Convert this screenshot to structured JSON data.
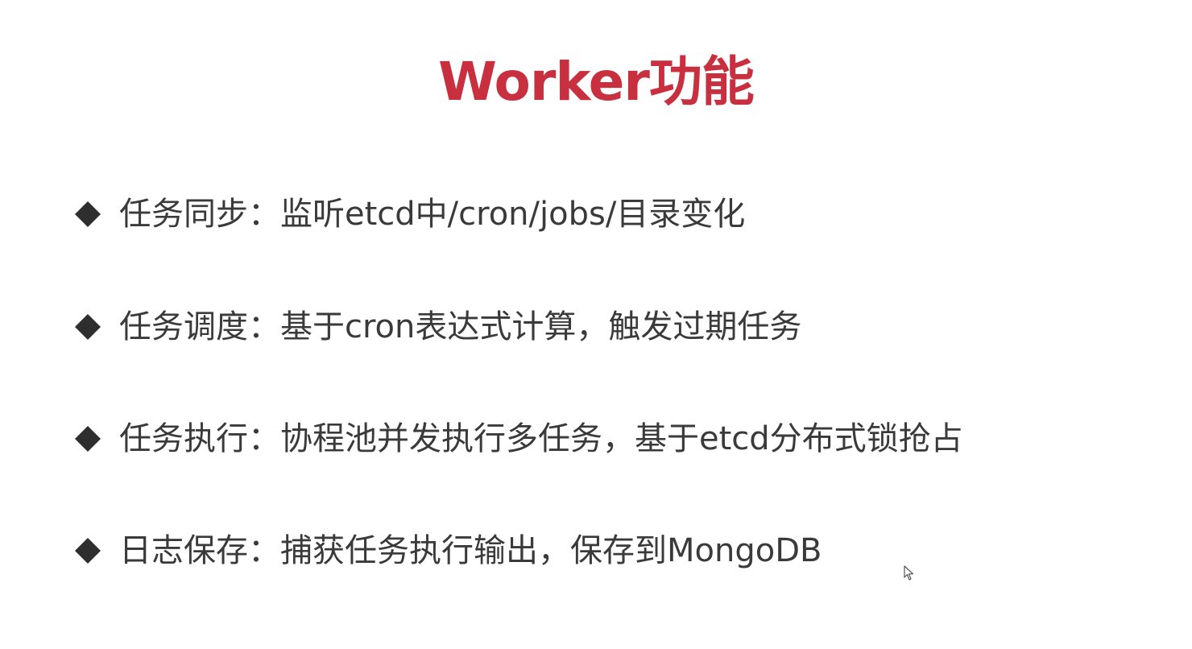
{
  "slide": {
    "title": "Worker功能",
    "title_color": "#c8303f",
    "text_color": "#3a3a3a",
    "bullet_color": "#2e2e2e",
    "bullet_icon": "diamond-icon",
    "bullets": [
      {
        "label": "任务同步",
        "separator": "：",
        "text": "监听etcd中/cron/jobs/目录变化"
      },
      {
        "label": "任务调度",
        "separator": "：",
        "text": "基于cron表达式计算，触发过期任务"
      },
      {
        "label": "任务执行",
        "separator": "：",
        "text": "协程池并发执行多任务，基于etcd分布式锁抢占"
      },
      {
        "label": "日志保存",
        "separator": "：",
        "text": "捕获任务执行输出，保存到MongoDB"
      }
    ]
  },
  "cursor": {
    "icon": "mouse-pointer-icon"
  }
}
